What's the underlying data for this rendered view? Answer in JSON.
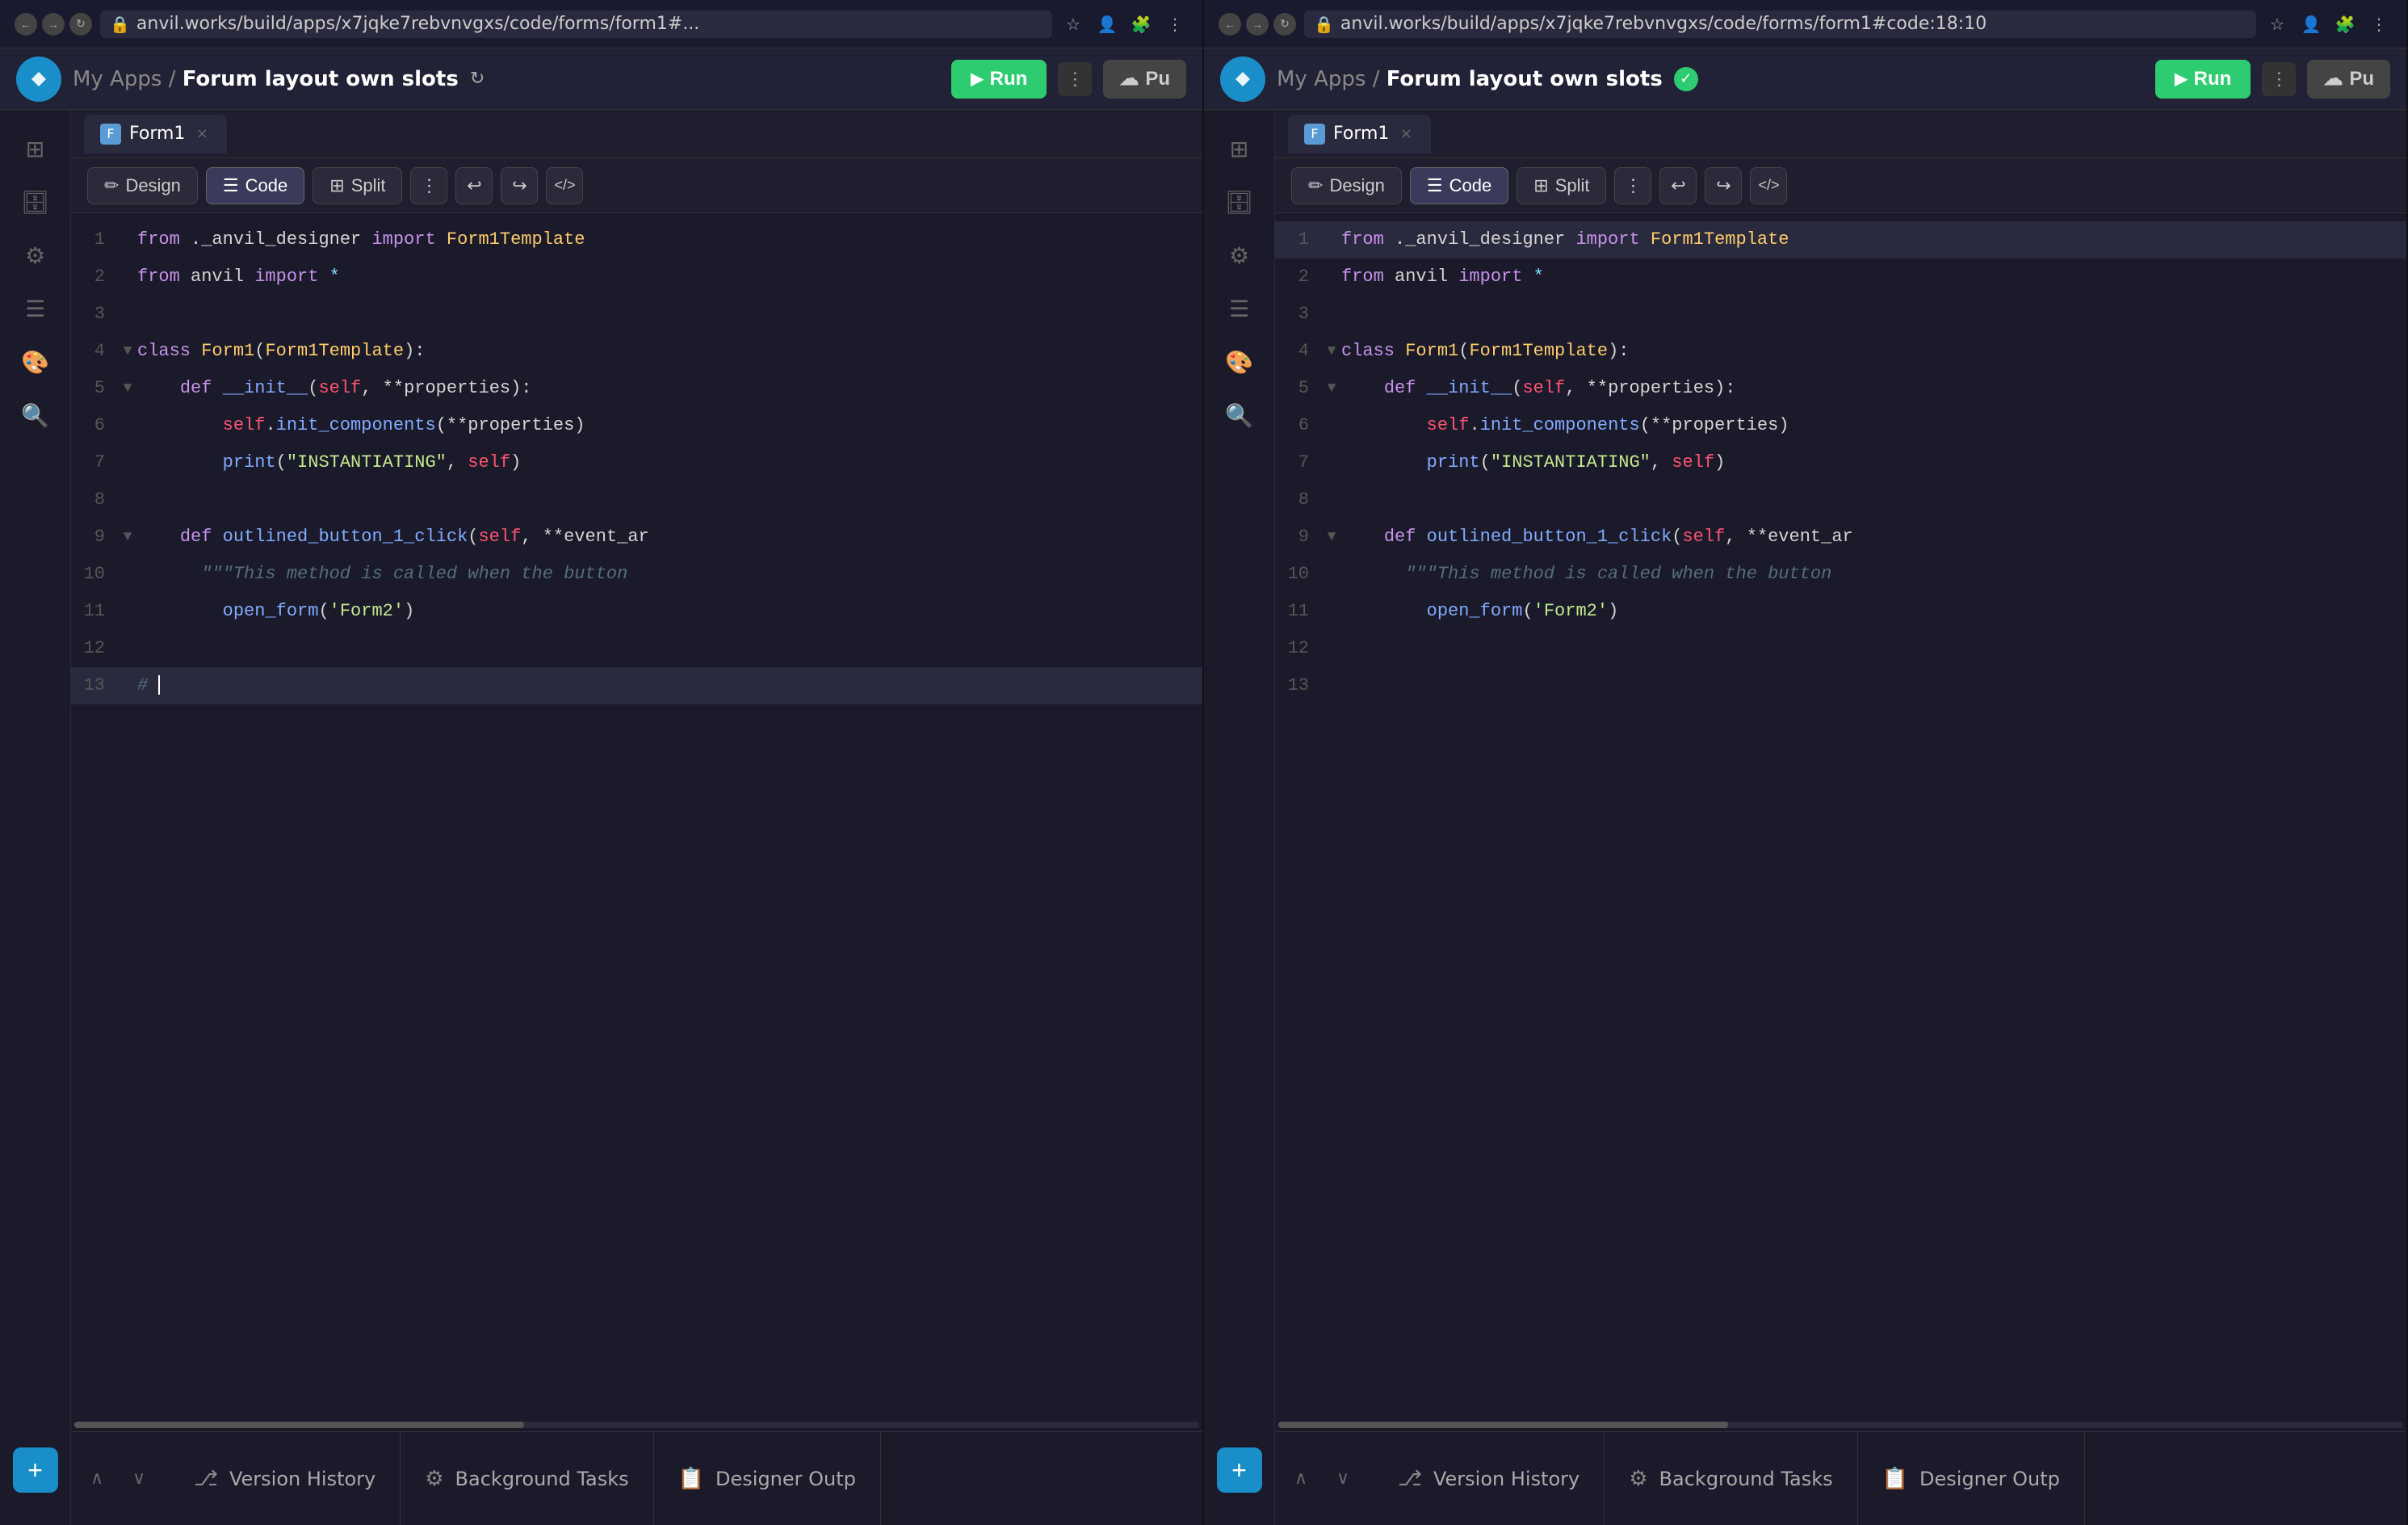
{
  "colors": {
    "bg_dark": "#1a1a2e",
    "bg_panel": "#1e1e2e",
    "bg_sidebar": "#1a1a2a",
    "bg_editor": "#1a1a2a",
    "accent_blue": "#1a8ec9",
    "accent_green": "#2ecc71",
    "tab_active_bg": "#2a2a3e"
  },
  "panels": [
    {
      "id": "left",
      "chrome": {
        "url": "anvil.works/build/apps/x7jqke7rebvnvgxs/code/forms/form1#...",
        "has_lock": true
      },
      "header": {
        "breadcrumb_prefix": "My Apps /",
        "app_name": "Forum layout own slots",
        "run_label": "Run",
        "publish_label": "Pu",
        "has_sync": true,
        "has_check": false
      },
      "tabs": [
        {
          "id": "form1",
          "label": "Form1",
          "active": true
        }
      ],
      "toolbar": {
        "design_label": "Design",
        "code_label": "Code",
        "split_label": "Split",
        "active": "Code"
      },
      "code": {
        "lines": [
          {
            "num": 1,
            "fold": false,
            "tokens": [
              {
                "t": "kw",
                "v": "from"
              },
              {
                "t": "plain",
                "v": " ._anvil_designer "
              },
              {
                "t": "kw",
                "v": "import"
              },
              {
                "t": "plain",
                "v": " "
              },
              {
                "t": "cls",
                "v": "Form1Template"
              }
            ]
          },
          {
            "num": 2,
            "fold": false,
            "tokens": [
              {
                "t": "kw",
                "v": "from"
              },
              {
                "t": "plain",
                "v": " anvil "
              },
              {
                "t": "kw",
                "v": "import"
              },
              {
                "t": "plain",
                "v": " "
              },
              {
                "t": "builtin",
                "v": "*"
              }
            ]
          },
          {
            "num": 3,
            "fold": false,
            "tokens": []
          },
          {
            "num": 4,
            "fold": true,
            "tokens": [
              {
                "t": "kw",
                "v": "class"
              },
              {
                "t": "plain",
                "v": " "
              },
              {
                "t": "cls",
                "v": "Form1"
              },
              {
                "t": "plain",
                "v": "("
              },
              {
                "t": "cls",
                "v": "Form1Template"
              },
              {
                "t": "plain",
                "v": "):"
              }
            ]
          },
          {
            "num": 5,
            "fold": true,
            "tokens": [
              {
                "t": "plain",
                "v": "    "
              },
              {
                "t": "kw",
                "v": "def"
              },
              {
                "t": "plain",
                "v": " "
              },
              {
                "t": "fn",
                "v": "__init__"
              },
              {
                "t": "plain",
                "v": "("
              },
              {
                "t": "selfkw",
                "v": "self"
              },
              {
                "t": "plain",
                "v": ", **properties):"
              }
            ]
          },
          {
            "num": 6,
            "fold": false,
            "tokens": [
              {
                "t": "plain",
                "v": "        "
              },
              {
                "t": "selfkw",
                "v": "self"
              },
              {
                "t": "plain",
                "v": "."
              },
              {
                "t": "fn",
                "v": "init_components"
              },
              {
                "t": "plain",
                "v": "(**properties)"
              }
            ]
          },
          {
            "num": 7,
            "fold": false,
            "tokens": [
              {
                "t": "plain",
                "v": "        "
              },
              {
                "t": "fn",
                "v": "print"
              },
              {
                "t": "plain",
                "v": "("
              },
              {
                "t": "str",
                "v": "\"INSTANTIATING\""
              },
              {
                "t": "plain",
                "v": ", "
              },
              {
                "t": "selfkw",
                "v": "self"
              },
              {
                "t": "plain",
                "v": ")"
              }
            ]
          },
          {
            "num": 8,
            "fold": false,
            "tokens": []
          },
          {
            "num": 9,
            "fold": true,
            "tokens": [
              {
                "t": "plain",
                "v": "    "
              },
              {
                "t": "kw",
                "v": "def"
              },
              {
                "t": "plain",
                "v": " "
              },
              {
                "t": "fn",
                "v": "outlined_button_1_click"
              },
              {
                "t": "plain",
                "v": "("
              },
              {
                "t": "selfkw",
                "v": "self"
              },
              {
                "t": "plain",
                "v": ", **event_ar"
              }
            ]
          },
          {
            "num": 10,
            "fold": false,
            "tokens": [
              {
                "t": "plain",
                "v": "      "
              },
              {
                "t": "cmt",
                "v": "\"\"\"This method is called when the button"
              }
            ]
          },
          {
            "num": 11,
            "fold": false,
            "tokens": [
              {
                "t": "plain",
                "v": "        "
              },
              {
                "t": "fn",
                "v": "open_form"
              },
              {
                "t": "plain",
                "v": "("
              },
              {
                "t": "str",
                "v": "'Form2'"
              },
              {
                "t": "plain",
                "v": ")"
              }
            ]
          },
          {
            "num": 12,
            "fold": false,
            "tokens": []
          },
          {
            "num": 13,
            "fold": false,
            "tokens": [
              {
                "t": "cmt",
                "v": "# "
              },
              {
                "t": "plain",
                "v": ""
              }
            ],
            "cursor": true,
            "highlighted": true
          }
        ]
      },
      "bottom_tabs": [
        {
          "id": "version-history",
          "label": "Version History",
          "icon": "⎇"
        },
        {
          "id": "background-tasks",
          "label": "Background Tasks",
          "icon": "⚙"
        },
        {
          "id": "designer-output",
          "label": "Designer Outp",
          "icon": "📋"
        }
      ]
    },
    {
      "id": "right",
      "chrome": {
        "url": "anvil.works/build/apps/x7jqke7rebvnvgxs/code/forms/form1#code:18:10",
        "has_lock": true
      },
      "header": {
        "breadcrumb_prefix": "My Apps /",
        "app_name": "Forum layout own slots",
        "run_label": "Run",
        "publish_label": "Pu",
        "has_sync": false,
        "has_check": true
      },
      "tabs": [
        {
          "id": "form1",
          "label": "Form1",
          "active": true
        }
      ],
      "toolbar": {
        "design_label": "Design",
        "code_label": "Code",
        "split_label": "Split",
        "active": "Code"
      },
      "code": {
        "lines": [
          {
            "num": 1,
            "fold": false,
            "tokens": [
              {
                "t": "kw",
                "v": "from"
              },
              {
                "t": "plain",
                "v": " ._anvil_designer "
              },
              {
                "t": "kw",
                "v": "import"
              },
              {
                "t": "plain",
                "v": " "
              },
              {
                "t": "cls",
                "v": "Form1Template"
              }
            ],
            "highlighted": true
          },
          {
            "num": 2,
            "fold": false,
            "tokens": [
              {
                "t": "kw",
                "v": "from"
              },
              {
                "t": "plain",
                "v": " anvil "
              },
              {
                "t": "kw",
                "v": "import"
              },
              {
                "t": "plain",
                "v": " "
              },
              {
                "t": "builtin",
                "v": "*"
              }
            ]
          },
          {
            "num": 3,
            "fold": false,
            "tokens": []
          },
          {
            "num": 4,
            "fold": true,
            "tokens": [
              {
                "t": "kw",
                "v": "class"
              },
              {
                "t": "plain",
                "v": " "
              },
              {
                "t": "cls",
                "v": "Form1"
              },
              {
                "t": "plain",
                "v": "("
              },
              {
                "t": "cls",
                "v": "Form1Template"
              },
              {
                "t": "plain",
                "v": "):"
              }
            ]
          },
          {
            "num": 5,
            "fold": true,
            "tokens": [
              {
                "t": "plain",
                "v": "    "
              },
              {
                "t": "kw",
                "v": "def"
              },
              {
                "t": "plain",
                "v": " "
              },
              {
                "t": "fn",
                "v": "__init__"
              },
              {
                "t": "plain",
                "v": "("
              },
              {
                "t": "selfkw",
                "v": "self"
              },
              {
                "t": "plain",
                "v": ", **properties):"
              }
            ]
          },
          {
            "num": 6,
            "fold": false,
            "tokens": [
              {
                "t": "plain",
                "v": "        "
              },
              {
                "t": "selfkw",
                "v": "self"
              },
              {
                "t": "plain",
                "v": "."
              },
              {
                "t": "fn",
                "v": "init_components"
              },
              {
                "t": "plain",
                "v": "(**properties)"
              }
            ]
          },
          {
            "num": 7,
            "fold": false,
            "tokens": [
              {
                "t": "plain",
                "v": "        "
              },
              {
                "t": "fn",
                "v": "print"
              },
              {
                "t": "plain",
                "v": "("
              },
              {
                "t": "str",
                "v": "\"INSTANTIATING\""
              },
              {
                "t": "plain",
                "v": ", "
              },
              {
                "t": "selfkw",
                "v": "self"
              },
              {
                "t": "plain",
                "v": ")"
              }
            ]
          },
          {
            "num": 8,
            "fold": false,
            "tokens": []
          },
          {
            "num": 9,
            "fold": true,
            "tokens": [
              {
                "t": "plain",
                "v": "    "
              },
              {
                "t": "kw",
                "v": "def"
              },
              {
                "t": "plain",
                "v": " "
              },
              {
                "t": "fn",
                "v": "outlined_button_1_click"
              },
              {
                "t": "plain",
                "v": "("
              },
              {
                "t": "selfkw",
                "v": "self"
              },
              {
                "t": "plain",
                "v": ", **event_ar"
              }
            ]
          },
          {
            "num": 10,
            "fold": false,
            "tokens": [
              {
                "t": "plain",
                "v": "      "
              },
              {
                "t": "cmt",
                "v": "\"\"\"This method is called when the button"
              }
            ]
          },
          {
            "num": 11,
            "fold": false,
            "tokens": [
              {
                "t": "plain",
                "v": "        "
              },
              {
                "t": "fn",
                "v": "open_form"
              },
              {
                "t": "plain",
                "v": "("
              },
              {
                "t": "str",
                "v": "'Form2'"
              },
              {
                "t": "plain",
                "v": ")"
              }
            ]
          },
          {
            "num": 12,
            "fold": false,
            "tokens": []
          },
          {
            "num": 13,
            "fold": false,
            "tokens": []
          }
        ]
      },
      "bottom_tabs": [
        {
          "id": "version-history",
          "label": "Version History",
          "icon": "⎇"
        },
        {
          "id": "background-tasks",
          "label": "Background Tasks",
          "icon": "⚙"
        },
        {
          "id": "designer-output",
          "label": "Designer Outp",
          "icon": "📋"
        }
      ]
    }
  ],
  "sidebar_icons": [
    "⊞",
    "🗄",
    "⚙",
    "☰",
    "🎨",
    "🔍"
  ]
}
